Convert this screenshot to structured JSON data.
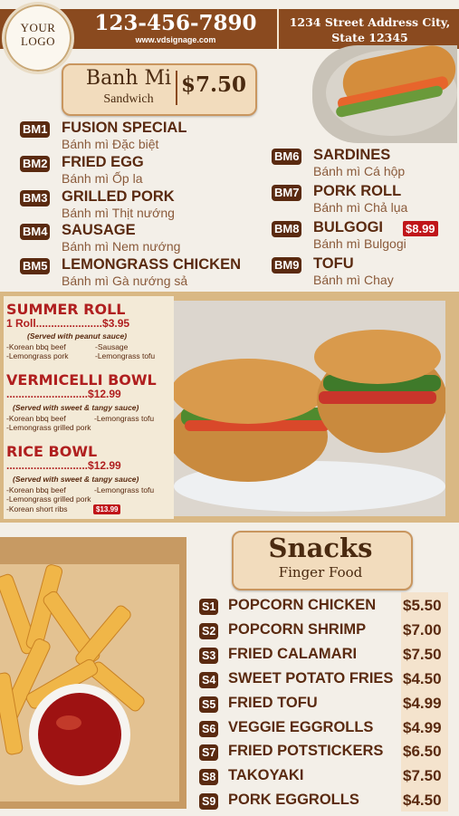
{
  "header": {
    "logo_line1": "YOUR",
    "logo_line2": "LOGO",
    "phone": "123-456-7890",
    "website": "www.vdsignage.com",
    "address_line1": "1234 Street Address City,",
    "address_line2": "State 12345"
  },
  "banh_mi": {
    "title": "Banh Mi",
    "subtitle": "Sandwich",
    "price": "$7.50",
    "items_left": [
      {
        "code": "BM1",
        "name": "FUSION SPECIAL",
        "vn": "Bánh mì Đặc biệt"
      },
      {
        "code": "BM2",
        "name": "FRIED EGG",
        "vn": "Bánh mì Ốp la"
      },
      {
        "code": "BM3",
        "name": "GRILLED PORK",
        "vn": "Bánh mì Thịt nướng"
      },
      {
        "code": "BM4",
        "name": "SAUSAGE",
        "vn": "Bánh mì Nem nướng"
      },
      {
        "code": "BM5",
        "name": "LEMONGRASS CHICKEN",
        "vn": "Bánh mì Gà nướng sả"
      }
    ],
    "items_right": [
      {
        "code": "BM6",
        "name": "SARDINES",
        "vn": "Bánh mì Cá hộp"
      },
      {
        "code": "BM7",
        "name": "PORK ROLL",
        "vn": "Bánh mì Chả lụa"
      },
      {
        "code": "BM8",
        "name": "BULGOGI",
        "vn": "Bánh mì Bulgogi",
        "badge": "$8.99"
      },
      {
        "code": "BM9",
        "name": "TOFU",
        "vn": "Bánh mì Chay"
      }
    ]
  },
  "summer_roll": {
    "title": "SUMMER ROLL",
    "line": "1 Roll......................$3.95",
    "note": "(Served with peanut sauce)",
    "opts": [
      "-Korean bbq beef",
      "-Sausage",
      "-Lemongrass pork",
      "-Lemongrass tofu"
    ]
  },
  "vermicelli": {
    "title": "VERMICELLI BOWL",
    "line": "...........................$12.99",
    "note": "(Served with sweet & tangy sauce)",
    "opts": [
      "-Korean bbq beef",
      "-Lemongrass tofu",
      "-Lemongrass grilled pork"
    ]
  },
  "rice_bowl": {
    "title": "RICE BOWL",
    "line": "...........................$12.99",
    "note": "(Served with sweet & tangy sauce)",
    "opts": [
      "-Korean bbq beef",
      "-Lemongrass tofu",
      "-Lemongrass grilled pork",
      "-Korean short ribs"
    ],
    "badge": "$13.99"
  },
  "snacks": {
    "title": "Snacks",
    "subtitle": "Finger Food",
    "items": [
      {
        "code": "S1",
        "name": "POPCORN CHICKEN",
        "price": "$5.50"
      },
      {
        "code": "S2",
        "name": "POPCORN SHRIMP",
        "price": "$7.00"
      },
      {
        "code": "S3",
        "name": "FRIED CALAMARI",
        "price": "$7.50"
      },
      {
        "code": "S4",
        "name": "SWEET POTATO FRIES",
        "price": "$4.50"
      },
      {
        "code": "S5",
        "name": "FRIED TOFU",
        "price": "$4.99"
      },
      {
        "code": "S6",
        "name": "VEGGIE EGGROLLS",
        "price": "$4.99"
      },
      {
        "code": "S7",
        "name": "FRIED POTSTICKERS",
        "price": "$6.50"
      },
      {
        "code": "S8",
        "name": "TAKOYAKI",
        "price": "$7.50"
      },
      {
        "code": "S9",
        "name": "PORK EGGROLLS",
        "price": "$4.50"
      }
    ]
  },
  "colors": {
    "brown": "#8a4a1f",
    "dark_brown": "#5a2a10",
    "red": "#b01f1f",
    "badge_red": "#c0161a"
  }
}
